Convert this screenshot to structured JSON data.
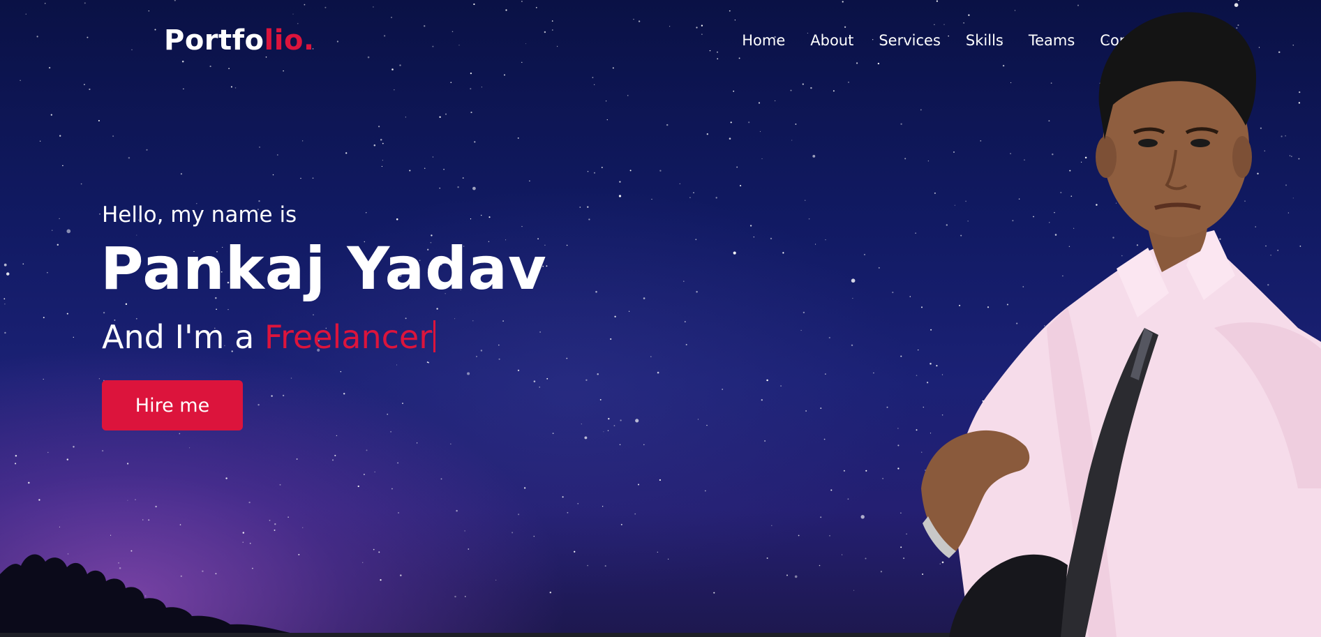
{
  "header": {
    "logo_main": "Portfo",
    "logo_accent": "lio."
  },
  "nav": {
    "items": [
      {
        "label": "Home"
      },
      {
        "label": "About"
      },
      {
        "label": "Services"
      },
      {
        "label": "Skills"
      },
      {
        "label": "Teams"
      },
      {
        "label": "Contact"
      }
    ]
  },
  "hero": {
    "intro": "Hello, my name is",
    "name": "Pankaj Yadav",
    "role_prefix": "And I'm a ",
    "role": "Freelancer",
    "button_label": "Hire me"
  },
  "colors": {
    "accent": "#dc143c",
    "text": "#ffffff",
    "sky_top": "#0a1145",
    "sky_mid": "#1b2175"
  },
  "images": {
    "portrait": "person-portrait-photo",
    "background": "starry-night-sky"
  }
}
